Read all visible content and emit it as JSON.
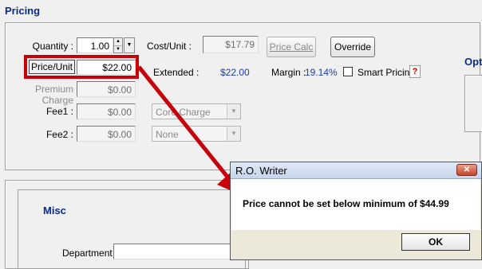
{
  "section_pricing": "Pricing",
  "quantity": {
    "label": "Quantity :",
    "value": "1.00"
  },
  "cost_unit": {
    "label": "Cost/Unit :",
    "value": "$17.79"
  },
  "price_calc_button": "Price Calc",
  "override_button": "Override",
  "price_unit": {
    "label": "Price/Unit",
    "value": "$22.00"
  },
  "extended": {
    "label": "Extended :",
    "value": "$22.00"
  },
  "margin": {
    "label": "Margin :",
    "value": "19.14%"
  },
  "smart_pricing": {
    "label": "Smart Pricing",
    "help": "?"
  },
  "premium_charge": {
    "label": "Premium Charge",
    "value": "$0.00"
  },
  "fee1": {
    "label": "Fee1 :",
    "value": "$0.00",
    "select": "Core Charge"
  },
  "fee2": {
    "label": "Fee2 :",
    "value": "$0.00",
    "select": "None"
  },
  "section_options": "Opt",
  "section_misc": "Misc",
  "department": {
    "label": "Department :",
    "value": ""
  },
  "dialog": {
    "title": "R.O. Writer",
    "message": "Price cannot be set below minimum of $44.99",
    "ok_button": "OK",
    "close_glyph": "✕"
  },
  "colors": {
    "annotation_red": "#c8000a",
    "header_blue": "#0a2a8a",
    "value_blue": "#1b3fb0"
  }
}
